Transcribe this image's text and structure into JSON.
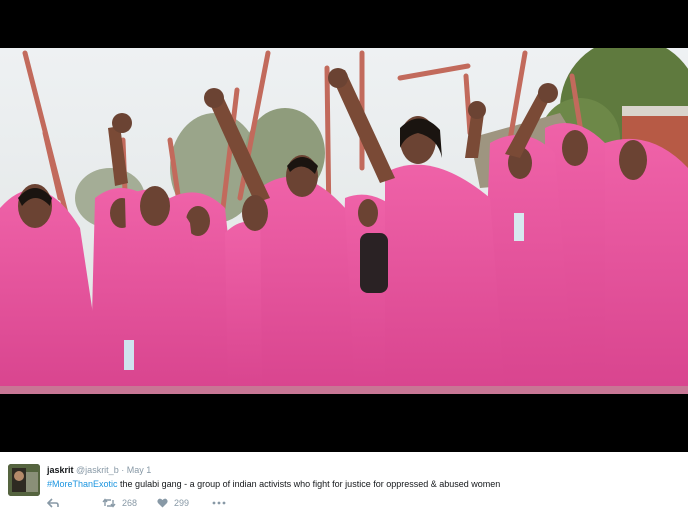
{
  "tweet": {
    "display_name": "jaskrit",
    "handle": "@jaskrit_b",
    "separator": "·",
    "date": "May 1",
    "hashtag": "#MoreThanExotic",
    "text": " the gulabi gang - a group of indian activists who fight for justice for oppressed & abused women",
    "actions": {
      "reply_icon": "reply-icon",
      "retweet_icon": "retweet-icon",
      "retweet_count": "268",
      "like_icon": "heart-icon",
      "like_count": "299",
      "more_icon": "more-dots-icon"
    }
  },
  "colors": {
    "link": "#1b95e0",
    "muted": "#8899a6",
    "text": "#14171a",
    "sari_pink": "#e8559e"
  }
}
